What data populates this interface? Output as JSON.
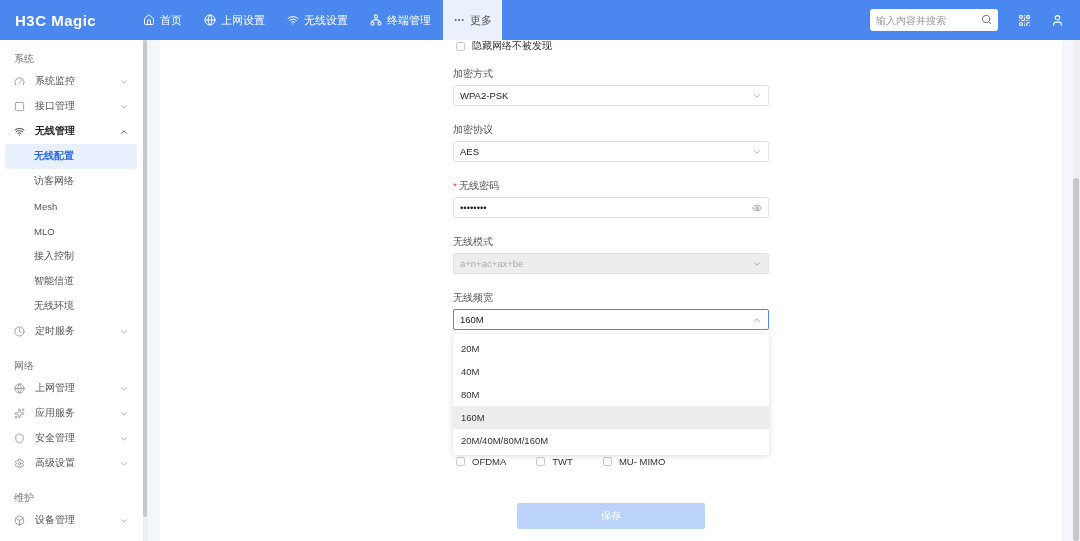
{
  "header": {
    "logo": "H3C Magic",
    "nav": [
      {
        "label": "首页",
        "selected": false
      },
      {
        "label": "上网设置",
        "selected": false
      },
      {
        "label": "无线设置",
        "selected": false
      },
      {
        "label": "终端管理",
        "selected": false
      },
      {
        "label": "更多",
        "selected": true
      }
    ],
    "search": {
      "placeholder": "输入内容并搜索"
    }
  },
  "sidebar": {
    "sections": [
      {
        "title": "系统",
        "items": [
          {
            "label": "系统监控",
            "expanded": false
          },
          {
            "label": "接口管理",
            "expanded": false
          },
          {
            "label": "无线管理",
            "expanded": true,
            "children": [
              {
                "label": "无线配置",
                "selected": true
              },
              {
                "label": "访客网络",
                "selected": false
              },
              {
                "label": "Mesh",
                "selected": false
              },
              {
                "label": "MLO",
                "selected": false
              },
              {
                "label": "接入控制",
                "selected": false
              },
              {
                "label": "智能信道",
                "selected": false
              },
              {
                "label": "无线环境",
                "selected": false
              }
            ]
          },
          {
            "label": "定时服务",
            "expanded": false
          }
        ]
      },
      {
        "title": "网络",
        "items": [
          {
            "label": "上网管理",
            "expanded": false
          },
          {
            "label": "应用服务",
            "expanded": false
          },
          {
            "label": "安全管理",
            "expanded": false
          },
          {
            "label": "高级设置",
            "expanded": false
          }
        ]
      },
      {
        "title": "维护",
        "items": [
          {
            "label": "设备管理",
            "expanded": false
          }
        ]
      }
    ]
  },
  "form": {
    "top_checkbox": {
      "label": "隐藏网络不被发现",
      "checked": false
    },
    "fields": [
      {
        "kind": "select",
        "label": "加密方式",
        "value": "WPA2-PSK",
        "disabled": false,
        "open": false
      },
      {
        "kind": "select",
        "label": "加密协议",
        "value": "AES",
        "disabled": false,
        "open": false
      },
      {
        "kind": "password",
        "label": "无线密码",
        "required_mark": "*",
        "value": "••••••••",
        "disabled": false,
        "open": false
      },
      {
        "kind": "select",
        "label": "无线模式",
        "value": "a+n+ac+ax+be",
        "disabled": true,
        "open": false
      },
      {
        "kind": "select",
        "label": "无线频宽",
        "value": "160M",
        "disabled": false,
        "open": true
      }
    ],
    "dropdown_options": [
      {
        "label": "20M",
        "selected": false
      },
      {
        "label": "40M",
        "selected": false
      },
      {
        "label": "80M",
        "selected": false
      },
      {
        "label": "160M",
        "selected": true
      },
      {
        "label": "20M/40M/80M/160M",
        "selected": false
      }
    ],
    "checkboxes": [
      {
        "label": "OFDMA",
        "checked": false
      },
      {
        "label": "TWT",
        "checked": false
      },
      {
        "label": "MU- MIMO",
        "checked": false
      }
    ],
    "save_button": {
      "label": "保存",
      "disabled": true
    }
  }
}
